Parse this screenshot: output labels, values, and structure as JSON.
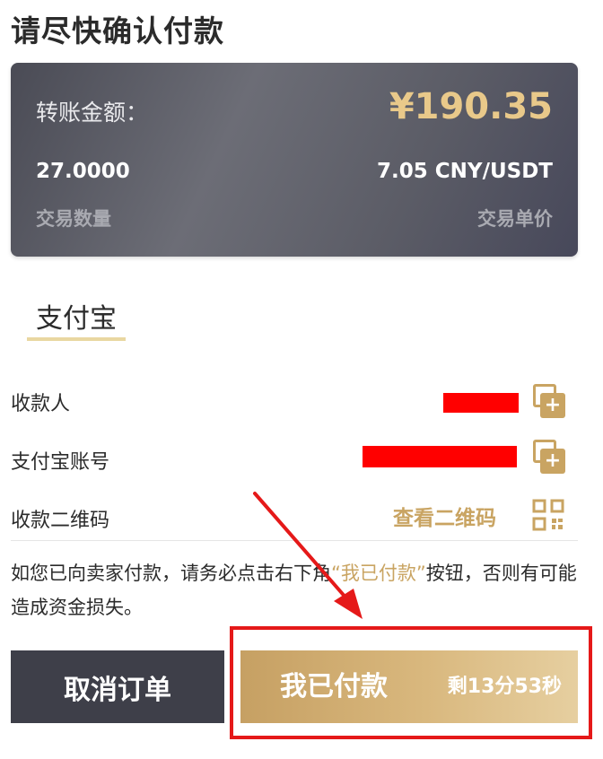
{
  "header": {
    "title": "请尽快确认付款"
  },
  "card": {
    "amount_label": "转账金额：",
    "amount_value": "¥190.35",
    "quantity_value": "27.0000",
    "quantity_label": "交易数量",
    "price_value": "7.05 CNY/USDT",
    "price_label": "交易单价"
  },
  "payment": {
    "tab_label": "支付宝",
    "rows": [
      {
        "label": "收款人",
        "icon": "copy-icon"
      },
      {
        "label": "支付宝账号",
        "icon": "copy-icon"
      },
      {
        "label": "收款二维码",
        "link": "查看二维码",
        "icon": "qr-code-icon"
      }
    ]
  },
  "notice": {
    "before": "如您已向卖家付款，请务必点击右下角",
    "highlight": "“我已付款”",
    "after": "按钮，否则有可能造成资金损失。"
  },
  "actions": {
    "cancel_label": "取消订单",
    "paid_label": "我已付款",
    "timer": "剩13分53秒"
  },
  "colors": {
    "accent_gold": "#c9a462",
    "annotation_red": "#e51919",
    "card_dark": "#4a4b55"
  }
}
